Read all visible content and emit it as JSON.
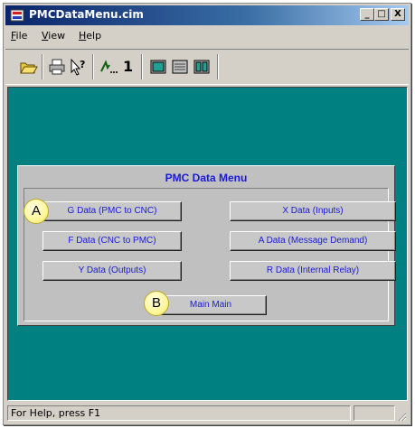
{
  "window": {
    "title": "PMCDataMenu.cim"
  },
  "title_buttons": {
    "minimize": "_",
    "maximize": "□",
    "close": "X"
  },
  "menu": [
    {
      "accel": "F",
      "rest": "ile"
    },
    {
      "accel": "V",
      "rest": "iew"
    },
    {
      "accel": "H",
      "rest": "elp"
    }
  ],
  "toolbar": {
    "icons": [
      "open-icon",
      "print-icon",
      "context-help-icon",
      "step-icon",
      "view-1-icon",
      "view-2-icon",
      "view-3-icon"
    ],
    "counter": "1"
  },
  "panel": {
    "title": "PMC Data Menu",
    "buttons": {
      "g_data": "G Data (PMC to CNC)",
      "x_data": "X Data (Inputs)",
      "f_data": "F Data (CNC to PMC)",
      "a_data": "A Data (Message Demand)",
      "y_data": "Y Data (Outputs)",
      "r_data": "R Data (Internal Relay)",
      "main": "Main Main"
    }
  },
  "callouts": {
    "a": "A",
    "b": "B"
  },
  "status": {
    "text": "For Help, press F1"
  },
  "colors": {
    "client_bg": "#008080",
    "panel_bg": "#c0c0c0",
    "button_text": "#1a1ad6",
    "callout": "#fff79a"
  }
}
